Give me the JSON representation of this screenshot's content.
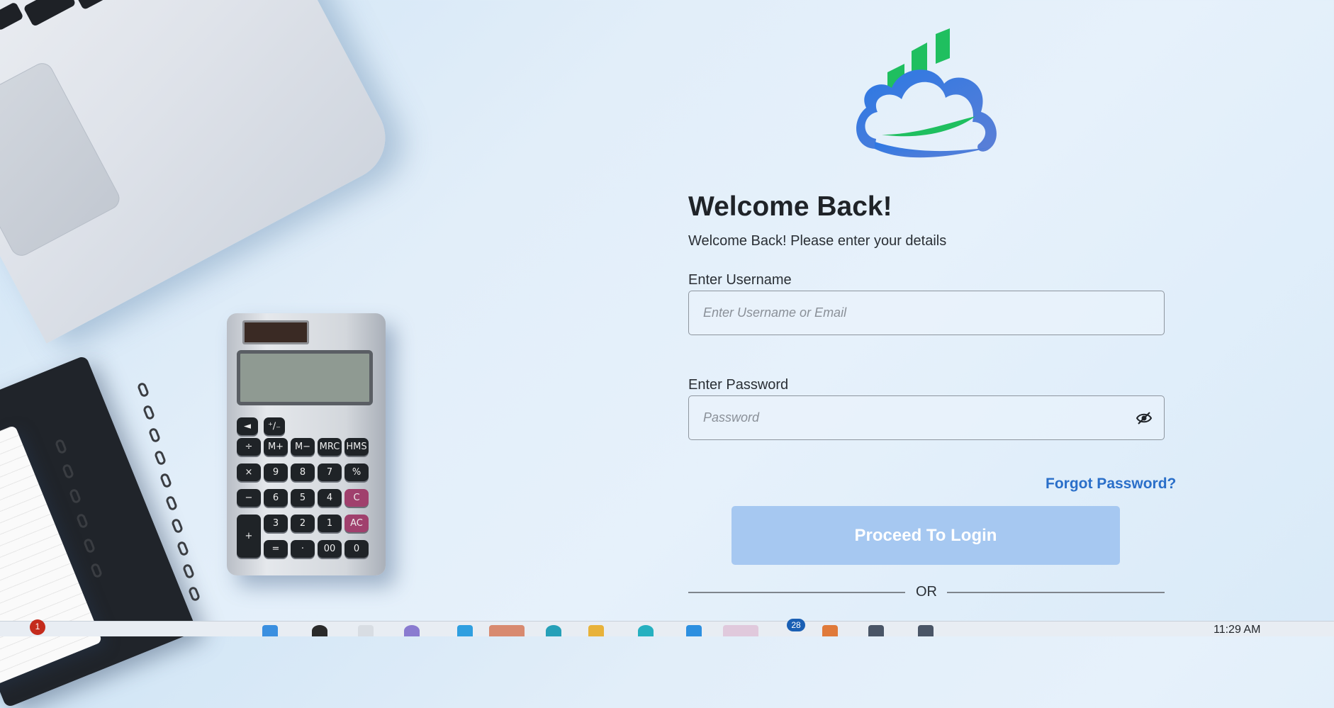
{
  "login": {
    "title": "Welcome Back!",
    "subtitle": "Welcome Back! Please enter your details",
    "username": {
      "label": "Enter Username",
      "placeholder": "Enter Username or Email",
      "value": ""
    },
    "password": {
      "label": "Enter Password",
      "placeholder": "Password",
      "value": ""
    },
    "forgot_password": "Forgot Password?",
    "submit_label": "Proceed To Login",
    "divider_label": "OR"
  },
  "colors": {
    "brand_blue": "#2a6fc9",
    "button_disabled": "#a6c8f1",
    "logo_green": "#1fbf5f",
    "logo_blue": "#2b78e4"
  },
  "taskbar": {
    "notification_count": "1",
    "app_badge": "28",
    "clock": "11:29 AM"
  },
  "icons": [
    "brand-cloud-logo",
    "eye-slash-icon"
  ]
}
